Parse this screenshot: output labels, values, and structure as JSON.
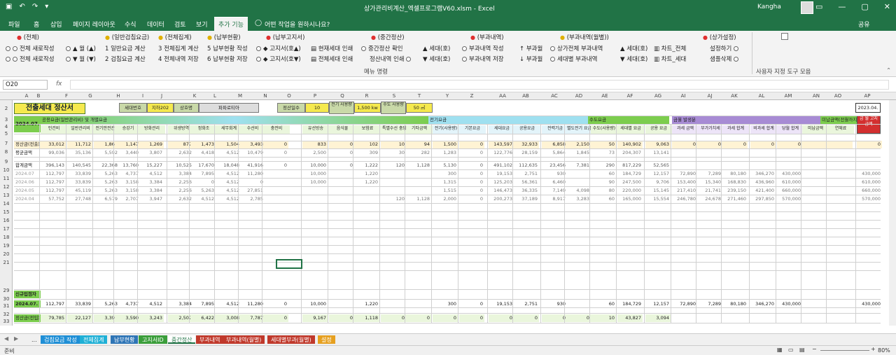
{
  "window": {
    "title": "상가관리비계산_엑셀프로그램V60.xlsm  -  Excel",
    "user": "Kangha"
  },
  "tabs": [
    "파일",
    "홈",
    "삽입",
    "페이지 레이아웃",
    "수식",
    "데이터",
    "검토",
    "보기",
    "추가 기능",
    "어떤 작업을 원하시나요?"
  ],
  "share": "공유",
  "ribbon": {
    "heads": [
      "(전체)",
      "(일반검침요금)",
      "(전체집계)",
      "(납부현황)",
      "(납부고지서)",
      "(중간정산)",
      "(부과내역)",
      "(부과내역(월별))",
      "(상가설정)"
    ],
    "items": [
      "전체 새로작성",
      "월 (▲)",
      "1 일반요금 계산",
      "3 전체집계 계산",
      "5 납부현황 작성",
      "고지서(호▲)",
      "현재세대 인쇄",
      "중간정산 확인",
      "세대(호)",
      "부과내역 작성",
      "부과월",
      "상가전체 부과내역",
      "세대(호)",
      "차트_전체",
      "설정하기",
      "전체 새로작성",
      "월 (▼)",
      "2 검침요금 계산",
      "4 전체내역 저장",
      "6 납부현황 저장",
      "고지서(호▼)",
      "전체세대 인쇄",
      "정산내역 인쇄",
      "세대(호)",
      "부과내역 저장",
      "부과월",
      "세대별 부과내역",
      "세대(호)",
      "차트_세대",
      "샘플삭제"
    ],
    "group1": "메뉴 명령",
    "group2": "사용자 지정 도구 모음"
  },
  "namebox": "O20",
  "cols": [
    "A",
    "B",
    "F",
    "G",
    "H",
    "I",
    "J",
    "K",
    "L",
    "M",
    "N",
    "O",
    "P",
    "Q",
    "R",
    "S",
    "T",
    "Y",
    "Z",
    "AA",
    "AB",
    "AC",
    "AD",
    "AE",
    "AF",
    "AG",
    "AI",
    "AJ",
    "AK",
    "AL",
    "AM",
    "AN",
    "AO",
    "AP"
  ],
  "rows": [
    "2",
    "3",
    "4",
    "5",
    "7",
    "8",
    "9",
    "10",
    "11",
    "12",
    "13",
    "14",
    "15",
    "16",
    "17",
    "18",
    "19",
    "20",
    "21",
    "29",
    "30",
    "31",
    "32",
    "33"
  ],
  "sheet": {
    "title": "전출세대 정산서",
    "info": [
      "세대번호",
      "지하202",
      "상호명",
      "파파로티아",
      "정산일수",
      "10",
      "전기 사용량",
      "1,500 kw",
      "수도 사용량",
      "50 ㎥"
    ],
    "date_right": "2023.04.",
    "period": "2024.07.",
    "group_heads": [
      "공용요금(일반관리비) 및 개별요금",
      "전기요금",
      "수도요금",
      "금월 발생분",
      "미납금액(전월까지)"
    ],
    "red_box": "금 월 고지금액",
    "subheads": [
      "인건비",
      "일반관리비",
      "전기안전관리",
      "승강기",
      "방화관리",
      "위생방역",
      "정화조",
      "세무회계",
      "수선비",
      "충전비",
      "유선방송",
      "음식물",
      "보험료",
      "특별수선 충당금",
      "기타금액",
      "전기(사용량)",
      "기본요금",
      "세대요금",
      "공용요금",
      "전력기금",
      "별도전기 요금",
      "수도(사용량)",
      "세대별 요금",
      "공용 요금",
      "과세 금액",
      "부가가치세",
      "과세 합계",
      "비과세 합계",
      "당월 합계",
      "미납금액",
      "연체료"
    ],
    "row7_label": "정산금(전출)",
    "row7": [
      "33,012",
      "11,712",
      "1,864",
      "1,147",
      "1,269",
      "877",
      "1,473",
      "1,504",
      "3,493",
      "0",
      "833",
      "0",
      "102",
      "10",
      "94",
      "1,500",
      "0",
      "143,597",
      "32,933",
      "6,858",
      "2,150",
      "50",
      "140,902",
      "9,063",
      "0",
      "0",
      "0",
      "0",
      "0",
      "",
      "",
      "0"
    ],
    "row8_label": "평균금액",
    "row8": [
      "99,036",
      "35,136",
      "5,592",
      "3,440",
      "3,807",
      "2,632",
      "4,418",
      "4,512",
      "10,479",
      "0",
      "2,500",
      "0",
      "309",
      "30",
      "282",
      "1,283",
      "0",
      "122,776",
      "28,159",
      "5,864",
      "1,845",
      "73",
      "204,307",
      "13,141",
      "",
      "",
      "",
      "",
      "",
      "",
      "",
      ""
    ],
    "row10_label": "합계금액",
    "row10": [
      "396,143",
      "140,545",
      "22,368",
      "13,760",
      "15,227",
      "10,525",
      "17,670",
      "18,048",
      "41,916",
      "0",
      "10,000",
      "0",
      "1,222",
      "120",
      "1,128",
      "5,130",
      "0",
      "491,102",
      "112,635",
      "23,456",
      "7,381",
      "290",
      "817,229",
      "52,565"
    ],
    "months": [
      "2024.07",
      "2024.06",
      "2024.05",
      "2024.04"
    ],
    "row11": [
      "112,797",
      "33,839",
      "5,263",
      "4,737",
      "4,512",
      "3,384",
      "7,895",
      "4,512",
      "11,280",
      "",
      "10,000",
      "",
      "1,220",
      "",
      "",
      "300",
      "0",
      "19,153",
      "2,751",
      "930",
      "",
      "60",
      "184,729",
      "12,157",
      "72,890",
      "7,289",
      "80,180",
      "346,270",
      "430,000",
      "",
      "",
      "430,000"
    ],
    "row12": [
      "112,797",
      "33,839",
      "5,263",
      "3,158",
      "3,384",
      "2,256",
      "0",
      "4,512",
      "0",
      "",
      "10,000",
      "",
      "1,220",
      "",
      "",
      "1,315",
      "0",
      "125,203",
      "56,361",
      "6,460",
      "",
      "90",
      "247,500",
      "9,706",
      "153,400",
      "15,340",
      "168,830",
      "436,960",
      "610,000",
      "",
      "",
      "610,000"
    ],
    "row13": [
      "112,797",
      "45,119",
      "5,263",
      "3,158",
      "3,384",
      "2,256",
      "5,263",
      "4,512",
      "27,851",
      "",
      "",
      "",
      "",
      "",
      "",
      "1,515",
      "0",
      "146,473",
      "36,335",
      "7,149",
      "4,098",
      "80",
      "220,000",
      "15,145",
      "217,410",
      "21,741",
      "239,150",
      "421,400",
      "660,000",
      "",
      "",
      "660,000"
    ],
    "row14": [
      "57,752",
      "27,748",
      "6,579",
      "2,707",
      "3,947",
      "2,632",
      "4,512",
      "4,512",
      "2,785",
      "",
      "",
      "",
      "",
      "120",
      "1,128",
      "2,000",
      "0",
      "200,273",
      "37,189",
      "8,917",
      "3,283",
      "60",
      "165,000",
      "15,554",
      "246,780",
      "24,678",
      "271,460",
      "297,850",
      "570,000",
      "",
      "",
      "570,000"
    ],
    "row30_label": "신규입점자",
    "row31_label": "2024.07.",
    "row31": [
      "112,797",
      "33,839",
      "5,263",
      "4,737",
      "4,512",
      "3,384",
      "7,895",
      "4,512",
      "11,280",
      "0",
      "10,000",
      "",
      "1,220",
      "",
      "",
      "300",
      "0",
      "19,153",
      "2,751",
      "930",
      "",
      "60",
      "184,729",
      "12,157",
      "72,890",
      "7,289",
      "80,180",
      "346,270",
      "430,000",
      "",
      "",
      "430,000"
    ],
    "row33_label": "정산금(전입)",
    "row33": [
      "79,785",
      "22,127",
      "3,399",
      "3,590",
      "3,243",
      "2,507",
      "6,422",
      "3,008",
      "7,787",
      "0",
      "9,167",
      "0",
      "1,118",
      "0",
      "0",
      "0",
      "0",
      "0",
      "0",
      "0",
      "0",
      "10",
      "43,827",
      "3,094"
    ]
  },
  "sheettabs": [
    "...",
    "검침요금 작성",
    "전체집계",
    "납부현황",
    "고지서ID",
    "중간정산",
    "부과내역",
    "부과내역(월별)",
    "세대별부과(월별)",
    "설정"
  ],
  "sheettab_colors": [
    "#f0f0f0",
    "#1f8fd6",
    "#1fb0d6",
    "#2e75b6",
    "#3b9e3b",
    "#f0f0f0",
    "#c0392b",
    "#c0392b",
    "#c0392b",
    "#e6a020"
  ],
  "status": {
    "ready": "준비",
    "zoom": "80%"
  }
}
